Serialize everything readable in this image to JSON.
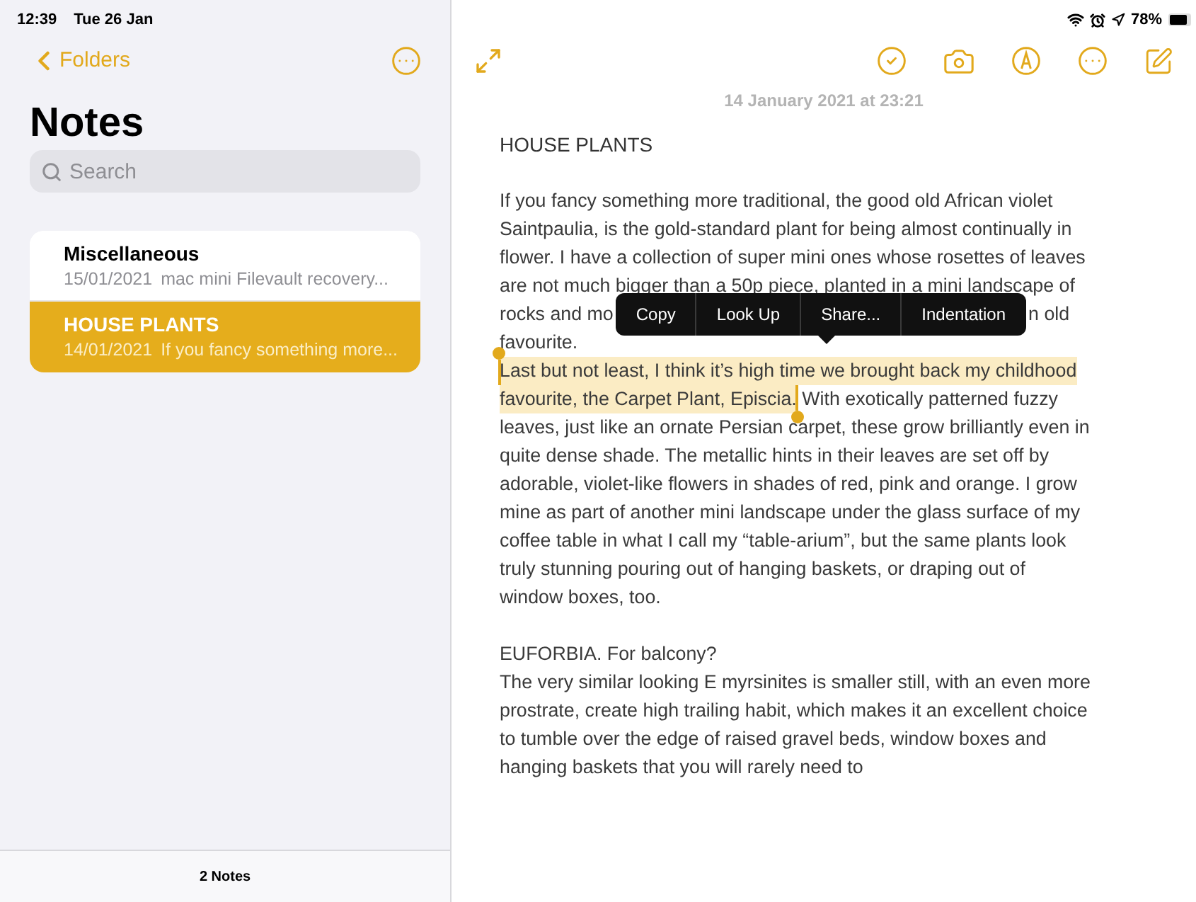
{
  "status_bar": {
    "time": "12:39",
    "date": "Tue 26 Jan",
    "battery_text": "78%"
  },
  "sidebar": {
    "back_label": "Folders",
    "title": "Notes",
    "search_placeholder": "Search",
    "notes": [
      {
        "title": "Miscellaneous",
        "date": "15/01/2021",
        "preview": "mac mini Filevault recovery...",
        "selected": false
      },
      {
        "title": "HOUSE PLANTS",
        "date": "14/01/2021",
        "preview": "If you fancy something more...",
        "selected": true
      }
    ],
    "footer": "2 Notes"
  },
  "editor": {
    "date_header": "14 January 2021 at 23:21",
    "heading": "HOUSE PLANTS",
    "lines": [
      {
        "kind": "line",
        "segments": [
          {
            "kind": "text",
            "text": "If you fancy something more traditional, the good old African violet",
            "selected": false
          }
        ]
      },
      {
        "kind": "line",
        "segments": [
          {
            "kind": "text",
            "text": "Saintpaulia, is the gold-standard plant for being almost continually in",
            "selected": false
          }
        ]
      },
      {
        "kind": "line",
        "segments": [
          {
            "kind": "text",
            "text": "flower. I have a collection of super mini ones whose rosettes of leaves",
            "selected": false
          }
        ]
      },
      {
        "kind": "line",
        "segments": [
          {
            "kind": "text",
            "text": "are not much bigger than a 50p piece, planted in a mini landscape of",
            "selected": false
          }
        ]
      },
      {
        "kind": "line",
        "segments": [
          {
            "kind": "text",
            "text": "rocks and mo",
            "selected": false
          },
          {
            "kind": "menu"
          },
          {
            "kind": "text",
            "text": "n old",
            "selected": false
          }
        ]
      },
      {
        "kind": "line",
        "segments": [
          {
            "kind": "text",
            "text": "favourite.",
            "selected": false
          }
        ]
      },
      {
        "kind": "line",
        "segments": [
          {
            "kind": "text",
            "text": "Last but not least, I think it’s high time we brought back my childhood",
            "selected": true
          }
        ]
      },
      {
        "kind": "line",
        "segments": [
          {
            "kind": "text",
            "text": "favourite, the Carpet Plant, Episcia.",
            "selected": true
          },
          {
            "kind": "text",
            "text": " With exotically patterned fuzzy",
            "selected": false
          }
        ]
      },
      {
        "kind": "line",
        "segments": [
          {
            "kind": "text",
            "text": "leaves, just like an ornate Persian carpet, these grow brilliantly even in",
            "selected": false
          }
        ]
      },
      {
        "kind": "line",
        "segments": [
          {
            "kind": "text",
            "text": "quite dense shade. The metallic hints in their leaves are set off by",
            "selected": false
          }
        ]
      },
      {
        "kind": "line",
        "segments": [
          {
            "kind": "text",
            "text": "adorable, violet-like flowers in shades of red, pink and orange. I grow",
            "selected": false
          }
        ]
      },
      {
        "kind": "line",
        "segments": [
          {
            "kind": "text",
            "text": "mine as part of another mini landscape under the glass surface of my",
            "selected": false
          }
        ]
      },
      {
        "kind": "line",
        "segments": [
          {
            "kind": "text",
            "text": "coffee table in what I call my “table-arium”, but the same plants look",
            "selected": false
          }
        ]
      },
      {
        "kind": "line",
        "segments": [
          {
            "kind": "text",
            "text": "truly stunning pouring out of hanging baskets, or draping out of",
            "selected": false
          }
        ]
      },
      {
        "kind": "line",
        "segments": [
          {
            "kind": "text",
            "text": "window boxes, too.",
            "selected": false
          }
        ]
      },
      {
        "kind": "gap"
      },
      {
        "kind": "line",
        "segments": [
          {
            "kind": "text",
            "text": "EUFORBIA. For balcony?",
            "selected": false
          }
        ]
      },
      {
        "kind": "line",
        "segments": [
          {
            "kind": "text",
            "text": "The very similar looking E myrsinites is smaller still, with an even more",
            "selected": false
          }
        ]
      },
      {
        "kind": "line",
        "segments": [
          {
            "kind": "text",
            "text": "prostrate, create high trailing habit, which makes it an excellent choice",
            "selected": false
          }
        ]
      },
      {
        "kind": "line",
        "segments": [
          {
            "kind": "text",
            "text": "to tumble over the edge of raised gravel beds, window boxes and",
            "selected": false
          }
        ]
      },
      {
        "kind": "line",
        "segments": [
          {
            "kind": "text",
            "text": "hanging baskets that you will rarely need to",
            "selected": false
          }
        ]
      }
    ],
    "context_menu": [
      "Copy",
      "Look Up",
      "Share...",
      "Indentation"
    ]
  }
}
